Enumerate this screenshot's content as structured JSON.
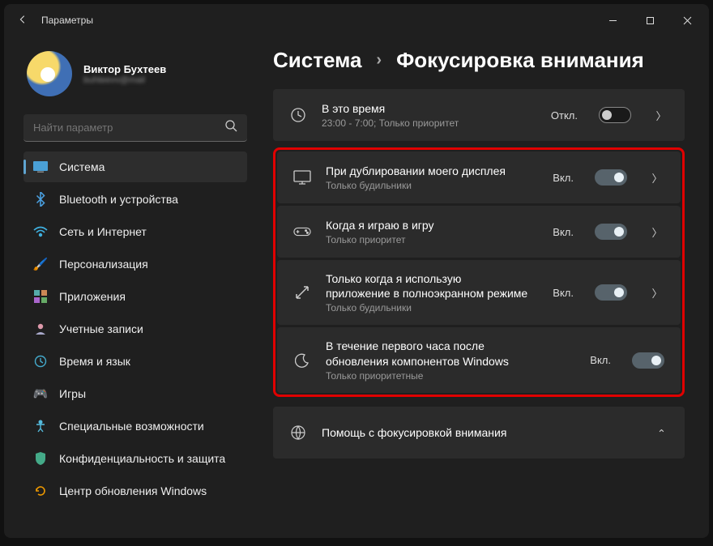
{
  "titlebar": {
    "title": "Параметры"
  },
  "profile": {
    "name": "Виктор Бухтеев",
    "email": "buhteevv@mail"
  },
  "search": {
    "placeholder": "Найти параметр"
  },
  "nav": [
    {
      "label": "Система",
      "icon": "💻",
      "selected": true
    },
    {
      "label": "Bluetooth и устройства",
      "icon": "bt"
    },
    {
      "label": "Сеть и Интернет",
      "icon": "wifi"
    },
    {
      "label": "Персонализация",
      "icon": "🖌️"
    },
    {
      "label": "Приложения",
      "icon": "apps"
    },
    {
      "label": "Учетные записи",
      "icon": "👤"
    },
    {
      "label": "Время и язык",
      "icon": "🕒"
    },
    {
      "label": "Игры",
      "icon": "🎮"
    },
    {
      "label": "Специальные возможности",
      "icon": "acc"
    },
    {
      "label": "Конфиденциальность и защита",
      "icon": "🛡️"
    },
    {
      "label": "Центр обновления Windows",
      "icon": "🔄"
    }
  ],
  "breadcrumb": {
    "parent": "Система",
    "current": "Фокусировка внимания"
  },
  "rows": {
    "time": {
      "title": "В это время",
      "sub": "23:00 - 7:00; Только приоритет",
      "state": "Откл."
    },
    "r1": {
      "title": "При дублировании моего дисплея",
      "sub": "Только будильники",
      "state": "Вкл."
    },
    "r2": {
      "title": "Когда я играю в игру",
      "sub": "Только приоритет",
      "state": "Вкл."
    },
    "r3": {
      "title": "Только когда я использую приложение в полноэкранном режиме",
      "sub": "Только будильники",
      "state": "Вкл."
    },
    "r4": {
      "title": "В течение первого часа после обновления компонентов Windows",
      "sub": "Только приоритетные",
      "state": "Вкл."
    }
  },
  "help": {
    "title": "Помощь с фокусировкой внимания"
  }
}
